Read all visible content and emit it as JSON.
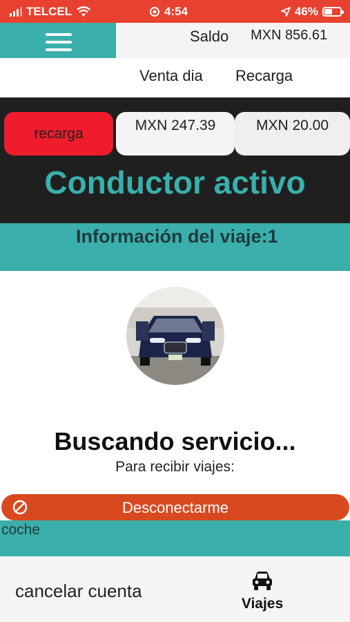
{
  "status_bar": {
    "carrier": "TELCEL",
    "time": "4:54",
    "battery": "46%",
    "signal_icon": "signal-bars-icon",
    "wifi_icon": "wifi-icon",
    "alarm_icon": "alarm-icon",
    "location_icon": "location-arrow-icon",
    "battery_icon": "battery-icon",
    "battery_level": 0.46
  },
  "header": {
    "menu_icon": "hamburger-menu-icon",
    "saldo_label": "Saldo",
    "saldo_value": "MXN 856.61"
  },
  "nav": {
    "venta_dia": "Venta dia",
    "recarga": "Recarga"
  },
  "summary": {
    "recarga_button": "recarga",
    "balance_1": "MXN 247.39",
    "balance_2": "MXN 20.00"
  },
  "driver_status": "Conductor activo",
  "trip_info": "Información del viaje:1",
  "vehicle_photo_icon": "car-photo",
  "searching": "Buscando servicio...",
  "receive_trips": "Para  recibir viajes:",
  "disconnect": {
    "label": "Desconectarme",
    "icon": "ban-icon"
  },
  "car_label": "coche",
  "bottom_nav": {
    "cancel_account": "cancelar cuenta",
    "viajes": "Viajes",
    "viajes_icon": "car-icon"
  },
  "colors": {
    "status_bar": "#e8412f",
    "teal": "#3aafab",
    "dark_panel": "#1f1f1f",
    "recarga_red": "#ef1c2c",
    "disconnect_orange": "#d9491f"
  }
}
